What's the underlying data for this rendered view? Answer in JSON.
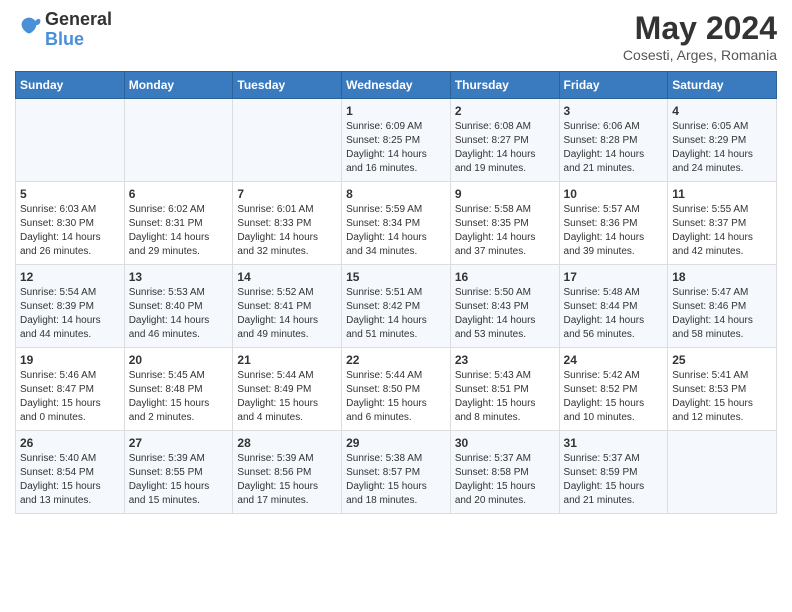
{
  "logo": {
    "text_general": "General",
    "text_blue": "Blue"
  },
  "title": "May 2024",
  "subtitle": "Cosesti, Arges, Romania",
  "days_of_week": [
    "Sunday",
    "Monday",
    "Tuesday",
    "Wednesday",
    "Thursday",
    "Friday",
    "Saturday"
  ],
  "weeks": [
    [
      {
        "day": "",
        "info": ""
      },
      {
        "day": "",
        "info": ""
      },
      {
        "day": "",
        "info": ""
      },
      {
        "day": "1",
        "info": "Sunrise: 6:09 AM\nSunset: 8:25 PM\nDaylight: 14 hours and 16 minutes."
      },
      {
        "day": "2",
        "info": "Sunrise: 6:08 AM\nSunset: 8:27 PM\nDaylight: 14 hours and 19 minutes."
      },
      {
        "day": "3",
        "info": "Sunrise: 6:06 AM\nSunset: 8:28 PM\nDaylight: 14 hours and 21 minutes."
      },
      {
        "day": "4",
        "info": "Sunrise: 6:05 AM\nSunset: 8:29 PM\nDaylight: 14 hours and 24 minutes."
      }
    ],
    [
      {
        "day": "5",
        "info": "Sunrise: 6:03 AM\nSunset: 8:30 PM\nDaylight: 14 hours and 26 minutes."
      },
      {
        "day": "6",
        "info": "Sunrise: 6:02 AM\nSunset: 8:31 PM\nDaylight: 14 hours and 29 minutes."
      },
      {
        "day": "7",
        "info": "Sunrise: 6:01 AM\nSunset: 8:33 PM\nDaylight: 14 hours and 32 minutes."
      },
      {
        "day": "8",
        "info": "Sunrise: 5:59 AM\nSunset: 8:34 PM\nDaylight: 14 hours and 34 minutes."
      },
      {
        "day": "9",
        "info": "Sunrise: 5:58 AM\nSunset: 8:35 PM\nDaylight: 14 hours and 37 minutes."
      },
      {
        "day": "10",
        "info": "Sunrise: 5:57 AM\nSunset: 8:36 PM\nDaylight: 14 hours and 39 minutes."
      },
      {
        "day": "11",
        "info": "Sunrise: 5:55 AM\nSunset: 8:37 PM\nDaylight: 14 hours and 42 minutes."
      }
    ],
    [
      {
        "day": "12",
        "info": "Sunrise: 5:54 AM\nSunset: 8:39 PM\nDaylight: 14 hours and 44 minutes."
      },
      {
        "day": "13",
        "info": "Sunrise: 5:53 AM\nSunset: 8:40 PM\nDaylight: 14 hours and 46 minutes."
      },
      {
        "day": "14",
        "info": "Sunrise: 5:52 AM\nSunset: 8:41 PM\nDaylight: 14 hours and 49 minutes."
      },
      {
        "day": "15",
        "info": "Sunrise: 5:51 AM\nSunset: 8:42 PM\nDaylight: 14 hours and 51 minutes."
      },
      {
        "day": "16",
        "info": "Sunrise: 5:50 AM\nSunset: 8:43 PM\nDaylight: 14 hours and 53 minutes."
      },
      {
        "day": "17",
        "info": "Sunrise: 5:48 AM\nSunset: 8:44 PM\nDaylight: 14 hours and 56 minutes."
      },
      {
        "day": "18",
        "info": "Sunrise: 5:47 AM\nSunset: 8:46 PM\nDaylight: 14 hours and 58 minutes."
      }
    ],
    [
      {
        "day": "19",
        "info": "Sunrise: 5:46 AM\nSunset: 8:47 PM\nDaylight: 15 hours and 0 minutes."
      },
      {
        "day": "20",
        "info": "Sunrise: 5:45 AM\nSunset: 8:48 PM\nDaylight: 15 hours and 2 minutes."
      },
      {
        "day": "21",
        "info": "Sunrise: 5:44 AM\nSunset: 8:49 PM\nDaylight: 15 hours and 4 minutes."
      },
      {
        "day": "22",
        "info": "Sunrise: 5:44 AM\nSunset: 8:50 PM\nDaylight: 15 hours and 6 minutes."
      },
      {
        "day": "23",
        "info": "Sunrise: 5:43 AM\nSunset: 8:51 PM\nDaylight: 15 hours and 8 minutes."
      },
      {
        "day": "24",
        "info": "Sunrise: 5:42 AM\nSunset: 8:52 PM\nDaylight: 15 hours and 10 minutes."
      },
      {
        "day": "25",
        "info": "Sunrise: 5:41 AM\nSunset: 8:53 PM\nDaylight: 15 hours and 12 minutes."
      }
    ],
    [
      {
        "day": "26",
        "info": "Sunrise: 5:40 AM\nSunset: 8:54 PM\nDaylight: 15 hours and 13 minutes."
      },
      {
        "day": "27",
        "info": "Sunrise: 5:39 AM\nSunset: 8:55 PM\nDaylight: 15 hours and 15 minutes."
      },
      {
        "day": "28",
        "info": "Sunrise: 5:39 AM\nSunset: 8:56 PM\nDaylight: 15 hours and 17 minutes."
      },
      {
        "day": "29",
        "info": "Sunrise: 5:38 AM\nSunset: 8:57 PM\nDaylight: 15 hours and 18 minutes."
      },
      {
        "day": "30",
        "info": "Sunrise: 5:37 AM\nSunset: 8:58 PM\nDaylight: 15 hours and 20 minutes."
      },
      {
        "day": "31",
        "info": "Sunrise: 5:37 AM\nSunset: 8:59 PM\nDaylight: 15 hours and 21 minutes."
      },
      {
        "day": "",
        "info": ""
      }
    ]
  ]
}
